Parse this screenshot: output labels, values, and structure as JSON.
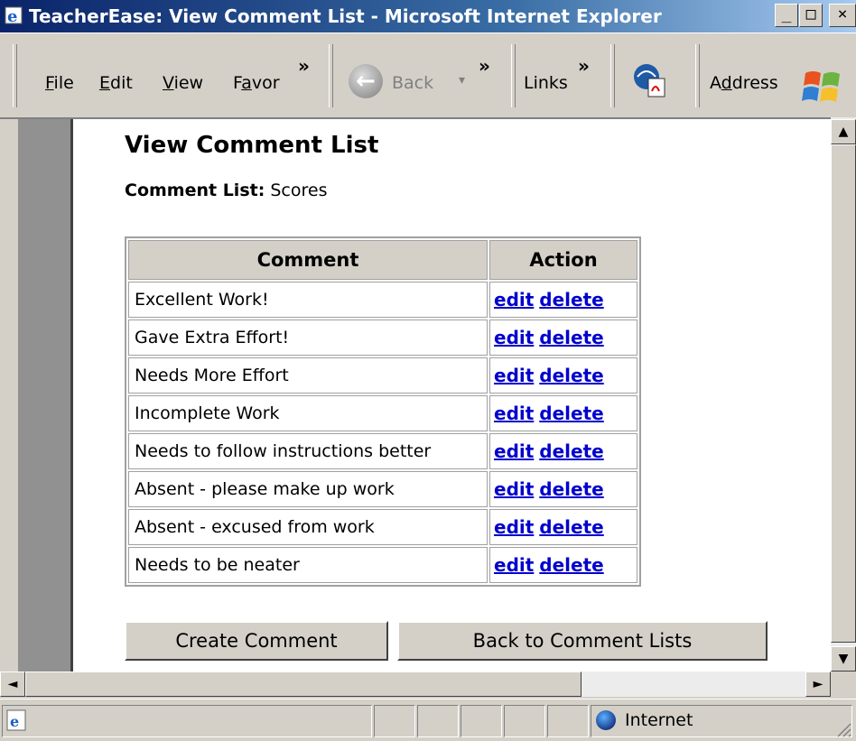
{
  "window": {
    "title": "TeacherEase: View Comment List - Microsoft Internet Explorer",
    "min_glyph": "_",
    "max_glyph": "□",
    "close_glyph": "×"
  },
  "toolbar": {
    "menu": [
      {
        "label": "File",
        "accel": "F"
      },
      {
        "label": "Edit",
        "accel": "E"
      },
      {
        "label": "View",
        "accel": "V"
      },
      {
        "label": "Favor",
        "accel": "a"
      }
    ],
    "chevron": "»",
    "back_label": "Back",
    "back_dropdown": "▾",
    "links_label": "Links",
    "address_label": "Address"
  },
  "page": {
    "title": "View Comment List",
    "list_label": "Comment List:",
    "list_name": "Scores",
    "table": {
      "headers": [
        "Comment",
        "Action"
      ],
      "edit_label": "edit",
      "delete_label": "delete",
      "rows": [
        "Excellent Work!",
        "Gave Extra Effort!",
        "Needs More Effort",
        "Incomplete Work",
        "Needs to follow instructions better",
        "Absent - please make up work",
        "Absent - excused from work",
        "Needs to be neater"
      ]
    },
    "buttons": {
      "create": "Create Comment",
      "back": "Back to Comment Lists"
    }
  },
  "scrollbars": {
    "up": "▲",
    "down": "▼",
    "left": "◄",
    "right": "►"
  },
  "status": {
    "zone": "Internet"
  },
  "colors": {
    "title_gradient_start": "#0a246a",
    "link": "#0000cc",
    "chrome": "#d4d0c8"
  }
}
